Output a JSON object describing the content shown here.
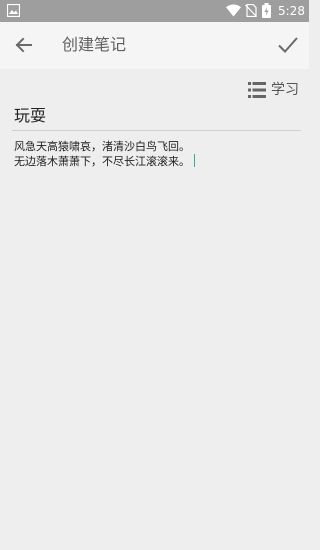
{
  "status_bar": {
    "time": "5:28",
    "icons": [
      "gallery-icon",
      "wifi-icon",
      "no-sim-icon",
      "battery-charging-icon"
    ]
  },
  "app_bar": {
    "title": "创建笔记",
    "back_icon": "arrow-back-icon",
    "confirm_icon": "check-icon"
  },
  "category": {
    "label": "学习",
    "icon": "list-icon"
  },
  "note": {
    "title": "玩耍",
    "body_lines": [
      "风急天高猿啸哀，渚清沙白鸟飞回。",
      "无边落木萧萧下，不尽长江滚滚来。"
    ]
  },
  "colors": {
    "status_bar_bg": "#9e9e9e",
    "app_bar_bg": "#f5f5f5",
    "page_bg": "#eeeeee",
    "cursor": "#3aa89c"
  }
}
